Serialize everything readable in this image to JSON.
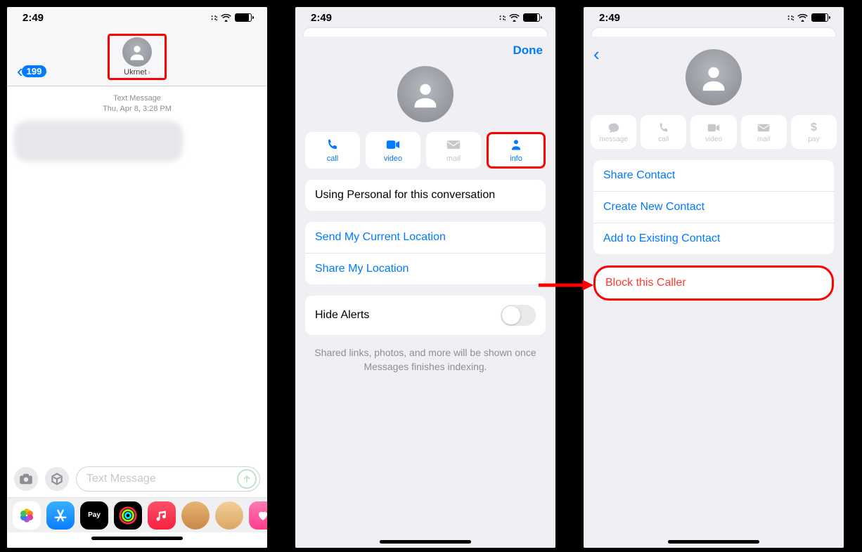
{
  "status": {
    "time": "2:49"
  },
  "screen1": {
    "back_count": "199",
    "contact_name": "Ukrnet",
    "msg_type": "Text Message",
    "msg_date": "Thu, Apr 8, 3:28 PM",
    "input_placeholder": "Text Message",
    "dock": {
      "photos": "Photos",
      "appstore": "App Store",
      "applepay": "Apple Pay",
      "fitness": "Fitness",
      "music": "Music",
      "memoji1": "Memoji",
      "memoji2": "Memoji",
      "hearts": "Hearts"
    }
  },
  "screen2": {
    "done": "Done",
    "actions": {
      "call": "call",
      "video": "video",
      "mail": "mail",
      "info": "info"
    },
    "using_line": "Using Personal for this conversation",
    "send_location": "Send My Current Location",
    "share_location": "Share My Location",
    "hide_alerts": "Hide Alerts",
    "indexing_note": "Shared links, photos, and more will be shown once Messages finishes indexing."
  },
  "screen3": {
    "actions": {
      "message": "message",
      "call": "call",
      "video": "video",
      "mail": "mail",
      "pay": "pay"
    },
    "share_contact": "Share Contact",
    "create_contact": "Create New Contact",
    "add_existing": "Add to Existing Contact",
    "block": "Block this Caller"
  }
}
